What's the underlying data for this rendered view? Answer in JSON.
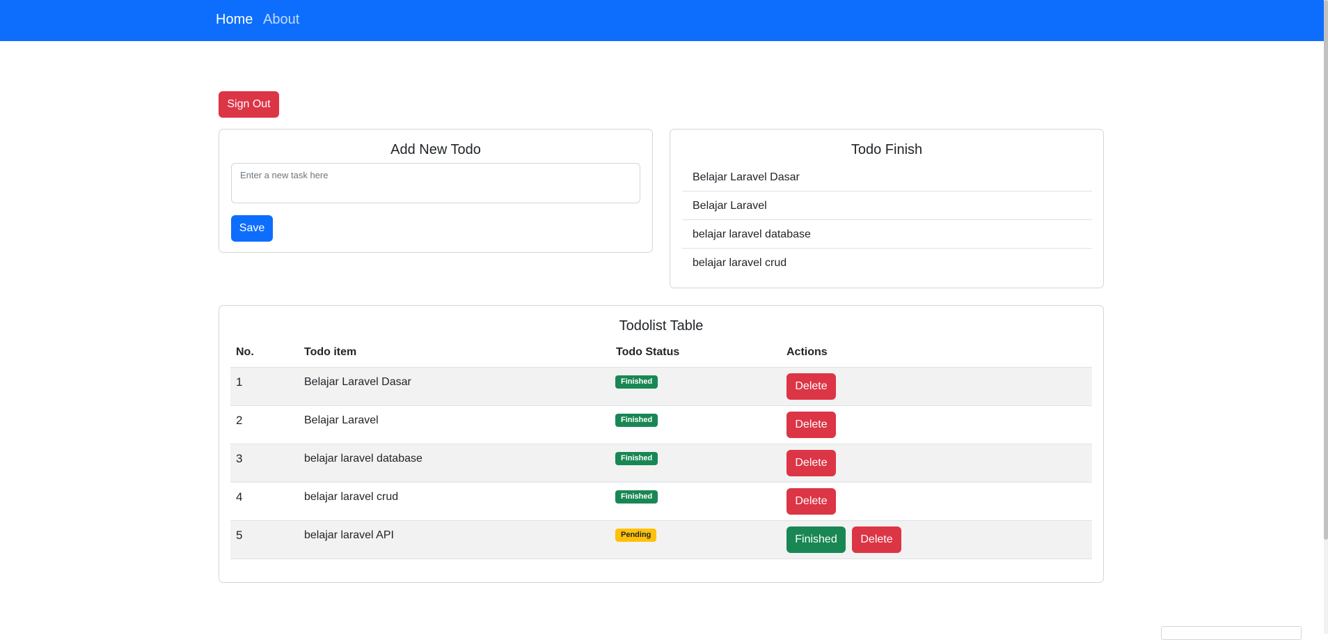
{
  "nav": {
    "home": "Home",
    "about": "About"
  },
  "signout_label": "Sign Out",
  "add_card": {
    "title": "Add New Todo",
    "placeholder": "Enter a new task here",
    "save_label": "Save"
  },
  "finish_card": {
    "title": "Todo Finish",
    "items": [
      "Belajar Laravel Dasar",
      "Belajar Laravel",
      "belajar laravel database",
      "belajar laravel crud"
    ]
  },
  "table": {
    "title": "Todolist Table",
    "headers": [
      "No.",
      "Todo item",
      "Todo Status",
      "Actions"
    ],
    "rows": [
      {
        "no": "1",
        "item": "Belajar Laravel Dasar",
        "status": "Finished",
        "delete": "Delete"
      },
      {
        "no": "2",
        "item": "Belajar Laravel",
        "status": "Finished",
        "delete": "Delete"
      },
      {
        "no": "3",
        "item": "belajar laravel database",
        "status": "Finished",
        "delete": "Delete"
      },
      {
        "no": "4",
        "item": "belajar laravel crud",
        "status": "Finished",
        "delete": "Delete"
      },
      {
        "no": "5",
        "item": "belajar laravel API",
        "status": "Pending",
        "finish": "Finished",
        "delete": "Delete"
      }
    ]
  },
  "colors": {
    "primary": "#0d6efd",
    "danger": "#dc3545",
    "success": "#198754",
    "warning": "#ffc107"
  }
}
